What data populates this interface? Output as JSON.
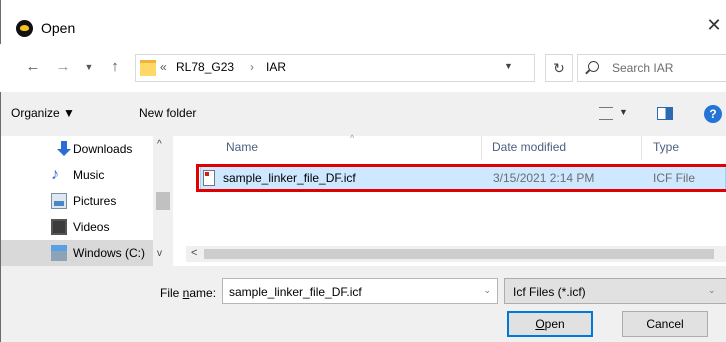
{
  "window": {
    "title": "Open",
    "close_glyph": "✕",
    "app_icon": "app-icon"
  },
  "nav": {
    "back_glyph": "←",
    "forward_glyph": "→",
    "recent_glyph": "▼",
    "up_glyph": "↑",
    "address": {
      "chevron": "«",
      "segments": [
        "RL78_G23",
        "IAR"
      ],
      "separator": "›",
      "dropdown_glyph": "▼"
    },
    "refresh_glyph": "↻",
    "search_placeholder": "Search IAR"
  },
  "commands": {
    "organize": "Organize ▼",
    "new_folder": "New folder",
    "view_dropdown": "▼",
    "help": "?"
  },
  "sidebar": {
    "items": [
      {
        "label": "Downloads",
        "icon": "download-icon"
      },
      {
        "label": "Music",
        "icon": "music-icon"
      },
      {
        "label": "Pictures",
        "icon": "pictures-icon"
      },
      {
        "label": "Videos",
        "icon": "videos-icon"
      },
      {
        "label": "Windows (C:)",
        "icon": "drive-icon",
        "selected": true
      }
    ],
    "scroll_up": "^",
    "scroll_down": "v"
  },
  "filelist": {
    "columns": {
      "name": "Name",
      "date": "Date modified",
      "type": "Type"
    },
    "sort_caret": "^",
    "rows": [
      {
        "name": "sample_linker_file_DF.icf",
        "date": "3/15/2021 2:14 PM",
        "type": "ICF File",
        "selected": true
      }
    ],
    "hscroll_left": "<",
    "highlight_color": "#e00000"
  },
  "bottom": {
    "file_name_label_pre": "File ",
    "file_name_label_u": "n",
    "file_name_label_post": "ame:",
    "file_name_value": "sample_linker_file_DF.icf",
    "file_name_dd": "⌄",
    "file_type_value": "Icf Files (*.icf)",
    "file_type_dd": "⌄",
    "open_u": "O",
    "open_rest": "pen",
    "cancel": "Cancel"
  },
  "colors": {
    "selection_bg": "#cde8ff",
    "accent": "#0078d7",
    "help": "#2374d6"
  }
}
